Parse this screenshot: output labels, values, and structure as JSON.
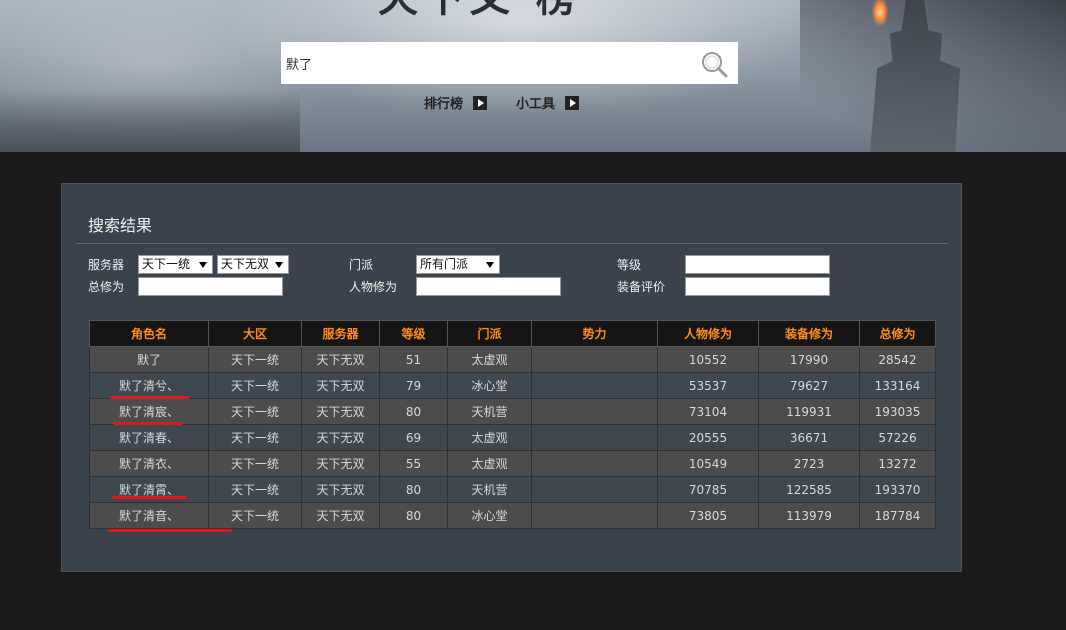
{
  "header": {
    "logo_text": "天下叉 榜"
  },
  "search": {
    "value": "默了"
  },
  "nav": {
    "items": [
      {
        "label": "排行榜"
      },
      {
        "label": "小工具"
      }
    ]
  },
  "panel": {
    "title": "搜索结果",
    "filters": {
      "server_label": "服务器",
      "server_select_1": "天下一统",
      "server_select_2": "天下无双",
      "sect_label": "门派",
      "sect_select": "所有门派",
      "level_label": "等级",
      "total_cultivation_label": "总修为",
      "char_cultivation_label": "人物修为",
      "equip_rating_label": "装备评价"
    }
  },
  "table": {
    "columns": [
      "角色名",
      "大区",
      "服务器",
      "等级",
      "门派",
      "势力",
      "人物修为",
      "装备修为",
      "总修为"
    ],
    "rows": [
      [
        "默了",
        "天下一统",
        "天下无双",
        "51",
        "太虚观",
        "",
        "10552",
        "17990",
        "28542"
      ],
      [
        "默了清兮、",
        "天下一统",
        "天下无双",
        "79",
        "冰心堂",
        "",
        "53537",
        "79627",
        "133164"
      ],
      [
        "默了清宸、",
        "天下一统",
        "天下无双",
        "80",
        "天机营",
        "",
        "73104",
        "119931",
        "193035"
      ],
      [
        "默了清春、",
        "天下一统",
        "天下无双",
        "69",
        "太虚观",
        "",
        "20555",
        "36671",
        "57226"
      ],
      [
        "默了清衣、",
        "天下一统",
        "天下无双",
        "55",
        "太虚观",
        "",
        "10549",
        "2723",
        "13272"
      ],
      [
        "默了清霄、",
        "天下一统",
        "天下无双",
        "80",
        "天机营",
        "",
        "70785",
        "122585",
        "193370"
      ],
      [
        "默了清音、",
        "天下一统",
        "天下无双",
        "80",
        "冰心堂",
        "",
        "73805",
        "113979",
        "187784"
      ]
    ]
  },
  "colors": {
    "header_text": "#ff8c1a",
    "annotation": "#e01818",
    "panel_bg": "#3a434b"
  }
}
